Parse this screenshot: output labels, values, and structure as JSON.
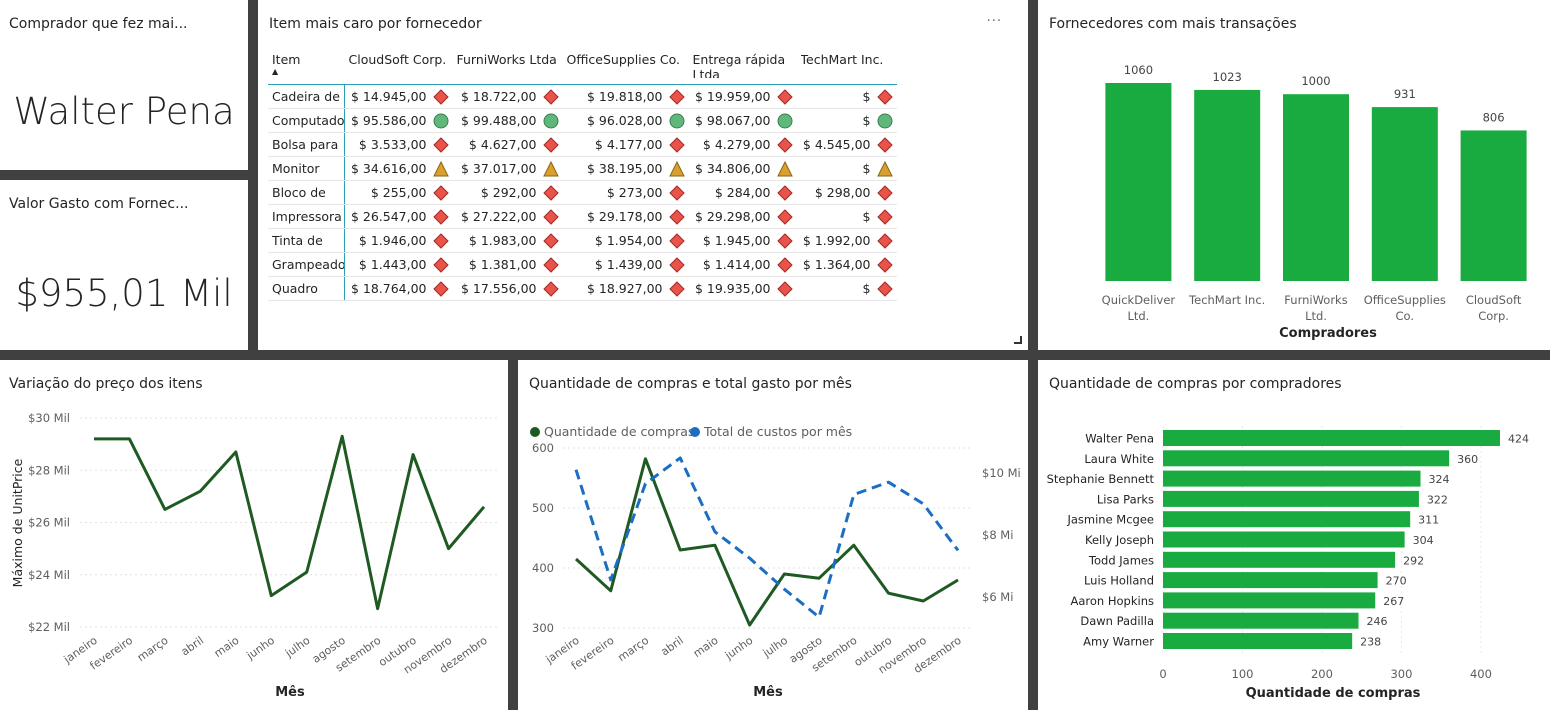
{
  "cards": {
    "top_buyer": {
      "title": "Comprador que fez mai...",
      "value": "Walter Pena"
    },
    "spent": {
      "title": "Valor Gasto com Fornec...",
      "value": "$955,01 Mil"
    }
  },
  "matrix": {
    "title": "Item mais caro por fornecedor",
    "more_label": "···",
    "corner_header": "Item",
    "columns": [
      "CloudSoft Corp.",
      "FurniWorks Ltda",
      "OfficeSupplies Co.",
      "Entrega rápida Ltda",
      "TechMart Inc."
    ],
    "rows": [
      {
        "item": "Cadeira de",
        "values": [
          "$ 14.945,00",
          "$ 18.722,00",
          "$ 19.818,00",
          "$ 19.959,00",
          "$"
        ],
        "icon": "diamond"
      },
      {
        "item": "Computado",
        "values": [
          "$ 95.586,00",
          "$ 99.488,00",
          "$ 96.028,00",
          "$ 98.067,00",
          "$"
        ],
        "icon": "circle"
      },
      {
        "item": "Bolsa para",
        "values": [
          "$ 3.533,00",
          "$ 4.627,00",
          "$ 4.177,00",
          "$ 4.279,00",
          "$ 4.545,00"
        ],
        "icon": "diamond"
      },
      {
        "item": "Monitor",
        "values": [
          "$ 34.616,00",
          "$ 37.017,00",
          "$ 38.195,00",
          "$ 34.806,00",
          "$"
        ],
        "icon": "triangle"
      },
      {
        "item": "Bloco de",
        "values": [
          "$ 255,00",
          "$ 292,00",
          "$ 273,00",
          "$ 284,00",
          "$ 298,00"
        ],
        "icon": "diamond"
      },
      {
        "item": "Impressora",
        "values": [
          "$ 26.547,00",
          "$ 27.222,00",
          "$ 29.178,00",
          "$ 29.298,00",
          "$"
        ],
        "icon": "diamond"
      },
      {
        "item": "Tinta de",
        "values": [
          "$ 1.946,00",
          "$ 1.983,00",
          "$ 1.954,00",
          "$ 1.945,00",
          "$ 1.992,00"
        ],
        "icon": "diamond"
      },
      {
        "item": "Grampeado",
        "values": [
          "$ 1.443,00",
          "$ 1.381,00",
          "$ 1.439,00",
          "$ 1.414,00",
          "$ 1.364,00"
        ],
        "icon": "diamond"
      },
      {
        "item": "Quadro",
        "values": [
          "$ 18.764,00",
          "$ 17.556,00",
          "$ 18.927,00",
          "$ 19.935,00",
          "$"
        ],
        "icon": "diamond"
      }
    ],
    "icon_colors": {
      "diamond": "#e8534a",
      "circle": "#5fb87a",
      "triangle": "#d9a030"
    }
  },
  "chart_data": [
    {
      "id": "suppliers",
      "type": "bar",
      "title": "Fornecedores com mais transações",
      "xlabel": "Compradores",
      "ylabel": "",
      "categories": [
        "QuickDeliver Ltd.",
        "TechMart Inc.",
        "FurniWorks Ltd.",
        "OfficeSupplies Co.",
        "CloudSoft Corp."
      ],
      "category_lines": [
        [
          "QuickDeliver",
          "Ltd."
        ],
        [
          "TechMart Inc."
        ],
        [
          "FurniWorks",
          "Ltd."
        ],
        [
          "OfficeSupplies",
          "Co."
        ],
        [
          "CloudSoft",
          "Corp."
        ]
      ],
      "values": [
        1060,
        1023,
        1000,
        931,
        806
      ],
      "data_labels": [
        "1060",
        "1023",
        "1000",
        "931",
        "806"
      ],
      "ylim": [
        0,
        1060
      ],
      "color": "#1aab40"
    },
    {
      "id": "price",
      "type": "line",
      "title": "Variação do preço dos itens",
      "xlabel": "Mês",
      "ylabel": "Máximo de UnitPrice",
      "categories": [
        "janeiro",
        "fevereiro",
        "março",
        "abril",
        "maio",
        "junho",
        "julho",
        "agosto",
        "setembro",
        "outubro",
        "novembro",
        "dezembro"
      ],
      "values": [
        29200,
        29200,
        26500,
        27200,
        28700,
        23200,
        24100,
        29300,
        22700,
        28600,
        25000,
        26600
      ],
      "ylim": [
        22000,
        30000
      ],
      "y_ticks": [
        22000,
        24000,
        26000,
        28000,
        30000
      ],
      "y_tick_labels": [
        "$22 Mil",
        "$24 Mil",
        "$26 Mil",
        "$28 Mil",
        "$30 Mil"
      ],
      "grid": true,
      "color": "#1e5a22"
    },
    {
      "id": "combo",
      "type": "line",
      "title": "Quantidade de compras e total gasto por mês",
      "xlabel": "Mês",
      "categories": [
        "janeiro",
        "fevereiro",
        "março",
        "abril",
        "maio",
        "junho",
        "julho",
        "agosto",
        "setembro",
        "outubro",
        "novembro",
        "dezembro"
      ],
      "series": [
        {
          "name": "Quantidade de compras",
          "axis": "left",
          "color": "#1e5a22",
          "dashed": false,
          "values": [
            415,
            362,
            582,
            430,
            438,
            305,
            390,
            383,
            438,
            358,
            345,
            380
          ]
        },
        {
          "name": "Total de custos por mês",
          "axis": "right",
          "color": "#1b6ec2",
          "dashed": true,
          "values": [
            10100000,
            6550000,
            9650000,
            10480000,
            8100000,
            7250000,
            6250000,
            5350000,
            9300000,
            9700000,
            9000000,
            7500000
          ]
        }
      ],
      "ylim_left": [
        300,
        600
      ],
      "y_ticks_left": [
        300,
        400,
        500,
        600
      ],
      "y_tick_labels_left": [
        "300",
        "400",
        "500",
        "600"
      ],
      "ylim_right": [
        5000000,
        10800000
      ],
      "y_ticks_right": [
        6000000,
        8000000,
        10000000
      ],
      "y_tick_labels_right": [
        "$6 Mi",
        "$8 Mi",
        "$10 Mi"
      ],
      "legend": "top-left",
      "grid": true
    },
    {
      "id": "buyers",
      "type": "bar",
      "orientation": "horizontal",
      "title": "Quantidade de compras por compradores",
      "xlabel": "Quantidade de compras",
      "ylabel": "",
      "categories": [
        "Walter Pena",
        "Laura White",
        "Stephanie Bennett",
        "Lisa Parks",
        "Jasmine Mcgee",
        "Kelly Joseph",
        "Todd James",
        "Luis Holland",
        "Aaron Hopkins",
        "Dawn Padilla",
        "Amy Warner"
      ],
      "values": [
        424,
        360,
        324,
        322,
        311,
        304,
        292,
        270,
        267,
        246,
        238
      ],
      "data_labels": [
        "424",
        "360",
        "324",
        "322",
        "311",
        "304",
        "292",
        "270",
        "267",
        "246",
        "238"
      ],
      "xlim": [
        0,
        424
      ],
      "x_ticks": [
        0,
        100,
        200,
        300,
        400
      ],
      "x_tick_labels": [
        "0",
        "100",
        "200",
        "300",
        "400"
      ],
      "grid": true,
      "color": "#1aab40"
    }
  ]
}
